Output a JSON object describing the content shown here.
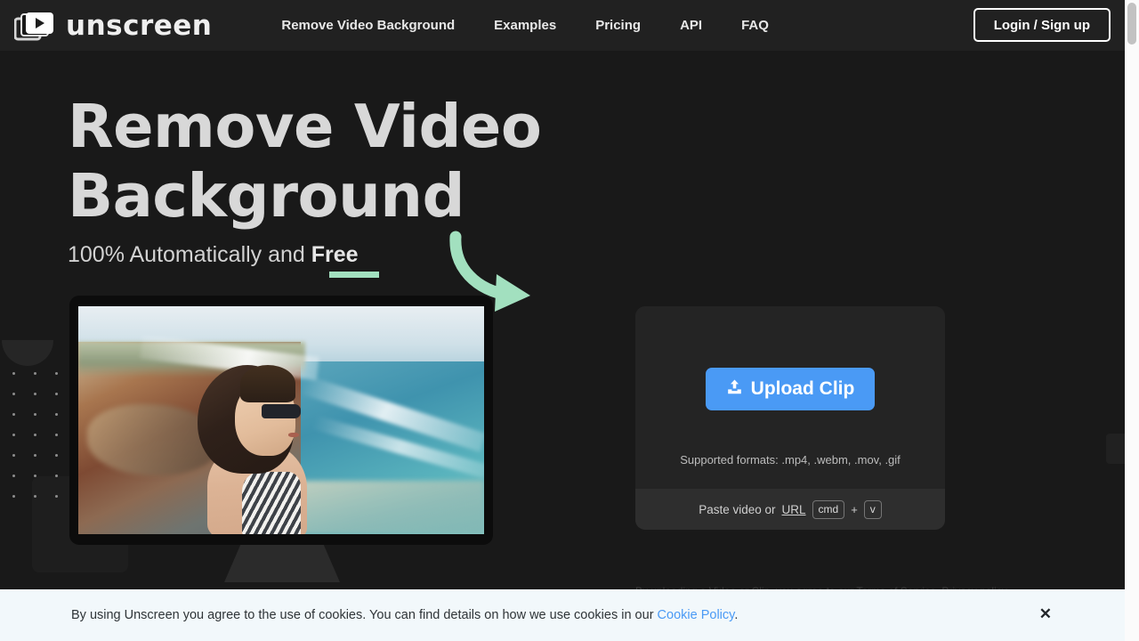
{
  "brand": {
    "wordmark": "unscreen",
    "icon": "video-frames-play-icon"
  },
  "nav": {
    "links": [
      {
        "label": "Remove Video Background"
      },
      {
        "label": "Examples"
      },
      {
        "label": "Pricing"
      },
      {
        "label": "API"
      },
      {
        "label": "FAQ"
      }
    ],
    "login_label": "Login / Sign up"
  },
  "hero": {
    "title_line1": "Remove Video",
    "title_line2": "Background",
    "sub_prefix": "100% Automatically and ",
    "sub_emphasis": "Free",
    "arrow": "curved-arrow-icon"
  },
  "upload": {
    "button_label": "Upload Clip",
    "button_icon": "upload-icon",
    "formats": "Supported formats: .mp4, .webm, .mov, .gif",
    "paste_label": "Paste video or ",
    "url_link": "URL",
    "key_primary": "cmd",
    "key_plus": "+",
    "key_secondary": "v"
  },
  "preview": {
    "alt": "woman-on-coastal-cliff-video"
  },
  "clipped": {
    "text": "By uploading a Video or Clip, you agree to our Terms of Service. Privacy policy."
  },
  "cookie": {
    "message_before": "By using Unscreen you agree to the use of cookies. You can find details on how we use cookies in our ",
    "link": "Cookie Policy",
    "message_after": ".",
    "close_icon": "close-icon"
  },
  "colors": {
    "page_bg": "#191919",
    "nav_bg": "#212121",
    "accent_blue": "#4a9af5",
    "accent_mint": "#a2e0bf",
    "panel_bg": "#242424",
    "panel_foot_bg": "#2e2e2e",
    "banner_bg": "#f2f8fb"
  },
  "scrollbar": {
    "position": "top"
  }
}
